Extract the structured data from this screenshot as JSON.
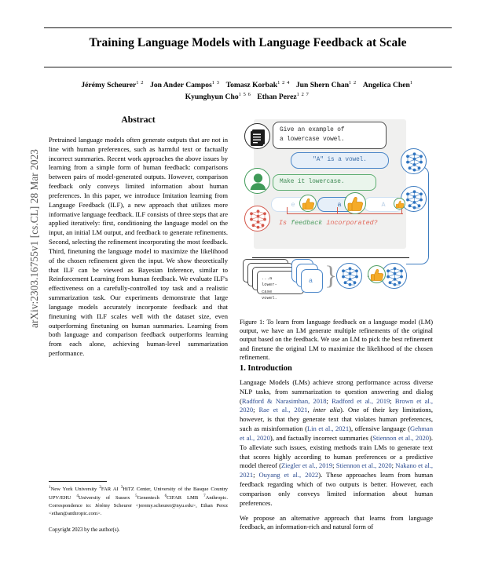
{
  "stamp": "arXiv:2303.16755v1  [cs.CL]  28 Mar 2023",
  "title": "Training Language Models with Language Feedback at Scale",
  "authors": [
    {
      "name": "Jérémy Scheurer",
      "affil": "1 2"
    },
    {
      "name": "Jon Ander Campos",
      "affil": "1 3"
    },
    {
      "name": "Tomasz Korbak",
      "affil": "1 2 4"
    },
    {
      "name": "Jun Shern Chan",
      "affil": "1 2"
    },
    {
      "name": "Angelica Chen",
      "affil": "1"
    },
    {
      "name": "Kyunghyun Cho",
      "affil": "1 5 6"
    },
    {
      "name": "Ethan Perez",
      "affil": "1 2 7"
    }
  ],
  "abstract": {
    "heading": "Abstract",
    "text": "Pretrained language models often generate outputs that are not in line with human preferences, such as harmful text or factually incorrect summaries. Recent work approaches the above issues by learning from a simple form of human feedback: comparisons between pairs of model-generated outputs. However, comparison feedback only conveys limited information about human preferences. In this paper, we introduce Imitation learning from Language Feedback (ILF), a new approach that utilizes more informative language feedback. ILF consists of three steps that are applied iteratively: first, conditioning the language model on the input, an initial LM output, and feedback to generate refinements. Second, selecting the refinement incorporating the most feedback. Third, finetuning the language model to maximize the likelihood of the chosen refinement given the input. We show theoretically that ILF can be viewed as Bayesian Inference, similar to Reinforcement Learning from human feedback. We evaluate ILF's effectiveness on a carefully-controlled toy task and a realistic summarization task. Our experiments demonstrate that large language models accurately incorporate feedback and that finetuning with ILF scales well with the dataset size, even outperforming finetuning on human summaries. Learning from both language and comparison feedback outperforms learning from each alone, achieving human-level summarization performance."
  },
  "footnote": {
    "marks": [
      "1",
      "2",
      "3",
      "4",
      "5",
      "6",
      "7"
    ],
    "text_parts": [
      "New York University ",
      "FAR AI ",
      "HiTZ Center, University of the Basque Country UPV/EHU ",
      "University of Sussex ",
      "Genentech ",
      "CIFAR LMB ",
      "Anthropic.  Correspondence to: Jérémy Scheurer <jeremy.scheurer@nyu.edu>, Ethan Perez <ethan@anthropic.com>."
    ],
    "copyright": "Copyright 2023 by the author(s)."
  },
  "figure": {
    "prompt_line1": "Give an example of",
    "prompt_line2": "a lowercase vowel.",
    "output": "\"A\" is a vowel.",
    "feedback": "Make it lowercase.",
    "refinements": [
      "e",
      "a",
      "A"
    ],
    "judge_word1": "Is",
    "judge_word2": "feedback",
    "judge_word3": "incorporated?",
    "stack_label_line1": "...a lower-",
    "stack_label_line2": "case vowel.",
    "stack_chip": "a",
    "icons": {
      "document": "document-icon",
      "human": "person-icon",
      "lm": "neural-network-icon",
      "judge": "neural-network-red-icon",
      "thumbs_up": "thumbs-up-icon"
    },
    "colors": {
      "blue": "#3d7cc0",
      "green": "#4f9e63",
      "red": "#d4564a",
      "gray_panel": "#f0f0ef",
      "dark": "#2b2b2b"
    }
  },
  "caption": {
    "label": "Figure 1:",
    "text": " To learn from language feedback on a language model (LM) output, we have an LM generate multiple refinements of the original output based on the feedback. We use an LM to pick the best refinement and finetune the original LM to maximize the likelihood of the chosen refinement."
  },
  "introduction": {
    "heading": "1. Introduction",
    "paragraph1_parts": [
      "Language Models (LMs) achieve strong performance across diverse NLP tasks, from summarization to question answering and dialog (",
      "Radford & Narasimhan, 2018",
      "; ",
      "Radford et al., 2019",
      "; ",
      "Brown et al., 2020",
      "; ",
      "Rae et al., 2021",
      ", ",
      "inter alia",
      "). One of their key limitations, however, is that they generate text that violates human preferences, such as misinformation (",
      "Lin et al., 2021",
      "), offensive language (",
      "Gehman et al., 2020",
      "), and factually incorrect summaries (",
      "Stiennon et al., 2020",
      "). To alleviate such issues, existing methods train LMs to generate text that scores highly according to human preferences or a predictive model thereof (",
      "Ziegler et al., 2019",
      "; ",
      "Stiennon et al., 2020",
      "; ",
      "Nakano et al., 2021",
      "; ",
      "Ouyang et al., 2022",
      "). These approaches learn from human feedback regarding which of two outputs is better. However, each comparison only conveys limited information about human preferences."
    ],
    "paragraph2": "We propose an alternative approach that learns from language feedback, an information-rich and natural form of"
  }
}
